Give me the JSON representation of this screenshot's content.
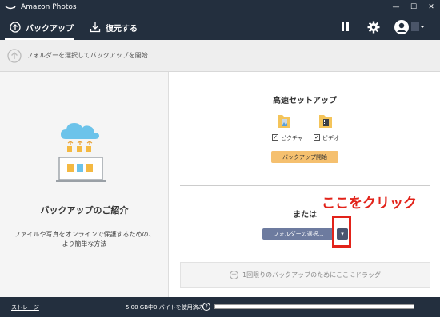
{
  "window": {
    "title": "Amazon Photos",
    "minimize_glyph": "—",
    "maximize_glyph": "☐",
    "close_glyph": "✕"
  },
  "nav": {
    "backup_tab": "バックアップ",
    "restore_tab": "復元する",
    "pause_icon": "pause-icon",
    "settings_icon": "gear-icon",
    "account_icon": "user-avatar-icon"
  },
  "info": {
    "text": "フォルダーを選択してバックアップを開始"
  },
  "intro": {
    "title": "バックアップのご紹介",
    "description_line1": "ファイルや写真をオンラインで保護するための、",
    "description_line2": "より簡単な方法"
  },
  "quick_setup": {
    "title": "高速セットアップ",
    "options": [
      {
        "label": "ピクチャ",
        "checked": true,
        "icon": "pictures-folder-icon"
      },
      {
        "label": "ビデオ",
        "checked": true,
        "icon": "videos-folder-icon"
      }
    ],
    "start_button": "バックアップ開始"
  },
  "alternative": {
    "or_label": "または",
    "select_folder_button": "フォルダーの選択...",
    "dropdown_glyph": "▾",
    "annotation": "ここをクリック",
    "drop_zone": "1回限りのバックアップのためにここにドラッグ"
  },
  "status": {
    "storage_link": "ストレージ",
    "usage_text": "5.00 GB中0 バイトを使用済み",
    "help_glyph": "?",
    "usage_fraction": 0.0
  },
  "colors": {
    "header_bg": "#232f3e",
    "accent_orange": "#f5c06f",
    "annotation_red": "#e2231a",
    "select_button": "#6d7b9f"
  }
}
